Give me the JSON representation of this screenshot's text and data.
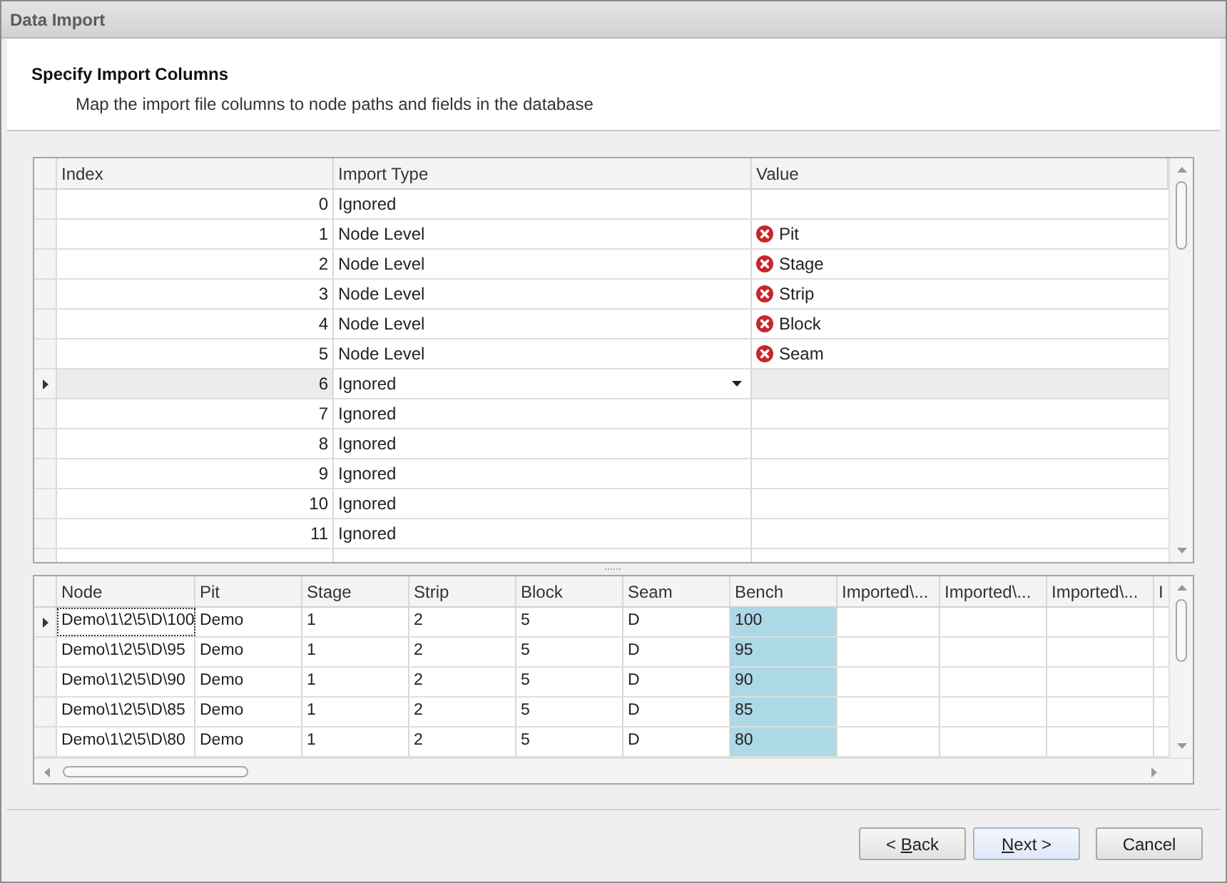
{
  "window": {
    "title": "Data Import"
  },
  "header": {
    "title": "Specify Import Columns",
    "subtitle": "Map the import file columns to node paths and fields in the database"
  },
  "mapping_grid": {
    "columns": [
      "Index",
      "Import Type",
      "Value"
    ],
    "rows": [
      {
        "index": "0",
        "import_type": "Ignored",
        "error": false,
        "selected": false
      },
      {
        "index": "1",
        "import_type": "Node Level",
        "value": "Pit",
        "error": true,
        "selected": false
      },
      {
        "index": "2",
        "import_type": "Node Level",
        "value": "Stage",
        "error": true,
        "selected": false
      },
      {
        "index": "3",
        "import_type": "Node Level",
        "value": "Strip",
        "error": true,
        "selected": false
      },
      {
        "index": "4",
        "import_type": "Node Level",
        "value": "Block",
        "error": true,
        "selected": false
      },
      {
        "index": "5",
        "import_type": "Node Level",
        "value": "Seam",
        "error": true,
        "selected": false
      },
      {
        "index": "6",
        "import_type": "Ignored",
        "error": false,
        "selected": true
      },
      {
        "index": "7",
        "import_type": "Ignored",
        "error": false,
        "selected": false
      },
      {
        "index": "8",
        "import_type": "Ignored",
        "error": false,
        "selected": false
      },
      {
        "index": "9",
        "import_type": "Ignored",
        "error": false,
        "selected": false
      },
      {
        "index": "10",
        "import_type": "Ignored",
        "error": false,
        "selected": false
      },
      {
        "index": "11",
        "import_type": "Ignored",
        "error": false,
        "selected": false
      }
    ]
  },
  "preview_grid": {
    "columns": [
      {
        "label": "Node",
        "highlighted": false
      },
      {
        "label": "Pit",
        "highlighted": false
      },
      {
        "label": "Stage",
        "highlighted": false
      },
      {
        "label": "Strip",
        "highlighted": false
      },
      {
        "label": "Block",
        "highlighted": false
      },
      {
        "label": "Seam",
        "highlighted": false
      },
      {
        "label": "Bench",
        "highlighted": true
      },
      {
        "label": "Imported\\...",
        "highlighted": false
      },
      {
        "label": "Imported\\...",
        "highlighted": false
      },
      {
        "label": "Imported\\...",
        "highlighted": false
      },
      {
        "label": "I",
        "highlighted": false
      }
    ],
    "rows": [
      {
        "cells": [
          "Demo\\1\\2\\5\\D\\100",
          "Demo",
          "1",
          "2",
          "5",
          "D",
          "100"
        ],
        "selected": true
      },
      {
        "cells": [
          "Demo\\1\\2\\5\\D\\95",
          "Demo",
          "1",
          "2",
          "5",
          "D",
          "95"
        ],
        "selected": false
      },
      {
        "cells": [
          "Demo\\1\\2\\5\\D\\90",
          "Demo",
          "1",
          "2",
          "5",
          "D",
          "90"
        ],
        "selected": false
      },
      {
        "cells": [
          "Demo\\1\\2\\5\\D\\85",
          "Demo",
          "1",
          "2",
          "5",
          "D",
          "85"
        ],
        "selected": false
      },
      {
        "cells": [
          "Demo\\1\\2\\5\\D\\80",
          "Demo",
          "1",
          "2",
          "5",
          "D",
          "80"
        ],
        "selected": false
      }
    ]
  },
  "buttons": [
    {
      "prefix": "< ",
      "mnemonic": "B",
      "suffix": "ack",
      "default": false
    },
    {
      "mnemonic": "N",
      "suffix": "ext >",
      "default": true
    },
    {
      "prefix": "Cancel",
      "default": false
    }
  ]
}
